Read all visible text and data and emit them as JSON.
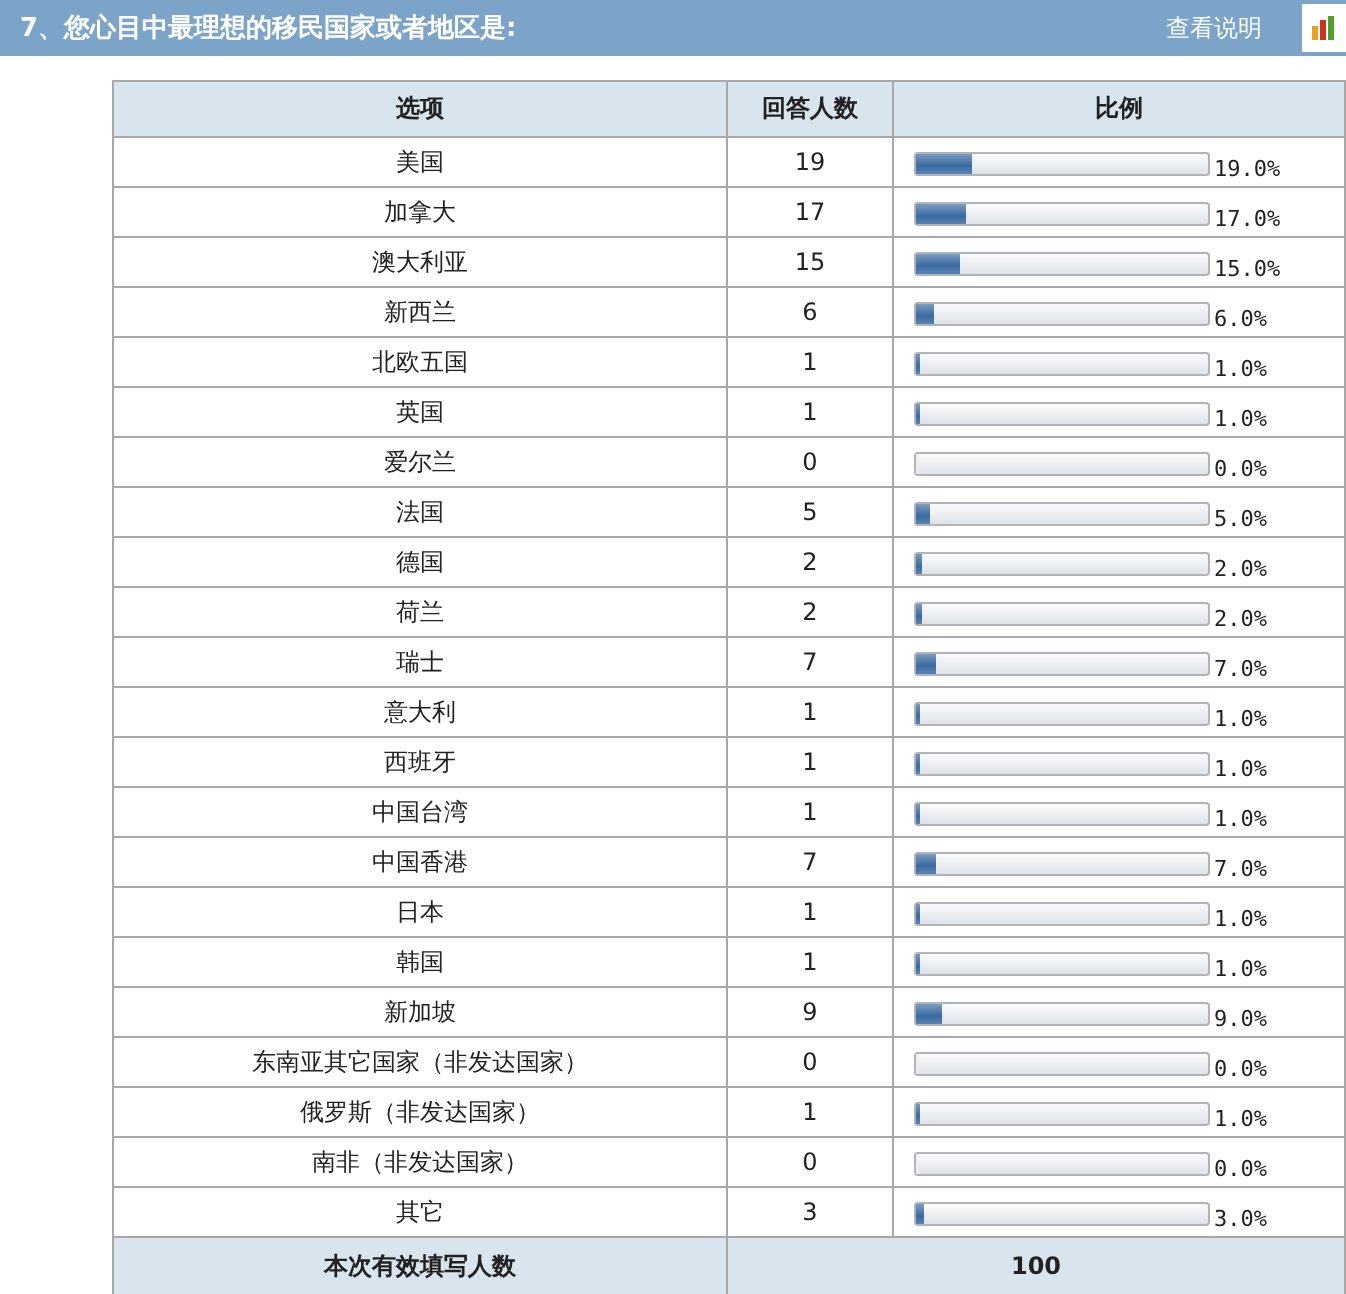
{
  "header": {
    "title": "7、您心目中最理想的移民国家或者地区是:",
    "help_link": "查看说明"
  },
  "table": {
    "columns": [
      "选项",
      "回答人数",
      "比例"
    ],
    "rows": [
      {
        "option": "美国",
        "count": "19",
        "level": 0.19,
        "percent": "19.0%"
      },
      {
        "option": "加拿大",
        "count": "17",
        "level": 0.17,
        "percent": "17.0%"
      },
      {
        "option": "澳大利亚",
        "count": "15",
        "level": 0.15,
        "percent": "15.0%"
      },
      {
        "option": "新西兰",
        "count": "6",
        "level": 0.06,
        "percent": "6.0%"
      },
      {
        "option": "北欧五国",
        "count": "1",
        "level": 0.01,
        "percent": "1.0%"
      },
      {
        "option": "英国",
        "count": "1",
        "level": 0.01,
        "percent": "1.0%"
      },
      {
        "option": "爱尔兰",
        "count": "0",
        "level": 0,
        "percent": "0.0%"
      },
      {
        "option": "法国",
        "count": "5",
        "level": 0.05,
        "percent": "5.0%"
      },
      {
        "option": "德国",
        "count": "2",
        "level": 0.02,
        "percent": "2.0%"
      },
      {
        "option": "荷兰",
        "count": "2",
        "level": 0.02,
        "percent": "2.0%"
      },
      {
        "option": "瑞士",
        "count": "7",
        "level": 0.07,
        "percent": "7.0%"
      },
      {
        "option": "意大利",
        "count": "1",
        "level": 0.01,
        "percent": "1.0%"
      },
      {
        "option": "西班牙",
        "count": "1",
        "level": 0.01,
        "percent": "1.0%"
      },
      {
        "option": "中国台湾",
        "count": "1",
        "level": 0.01,
        "percent": "1.0%"
      },
      {
        "option": "中国香港",
        "count": "7",
        "level": 0.07,
        "percent": "7.0%"
      },
      {
        "option": "日本",
        "count": "1",
        "level": 0.01,
        "percent": "1.0%"
      },
      {
        "option": "韩国",
        "count": "1",
        "level": 0.01,
        "percent": "1.0%"
      },
      {
        "option": "新加坡",
        "count": "9",
        "level": 0.09,
        "percent": "9.0%"
      },
      {
        "option": "东南亚其它国家（非发达国家）",
        "count": "0",
        "level": 0,
        "percent": "0.0%"
      },
      {
        "option": "俄罗斯（非发达国家）",
        "count": "1",
        "level": 0.01,
        "percent": "1.0%"
      },
      {
        "option": "南非（非发达国家）",
        "count": "0",
        "level": 0,
        "percent": "0.0%"
      },
      {
        "option": "其它",
        "count": "3",
        "level": 0.03,
        "percent": "3.0%"
      }
    ],
    "footer": {
      "label": "本次有效填写人数",
      "value": "100"
    }
  }
}
